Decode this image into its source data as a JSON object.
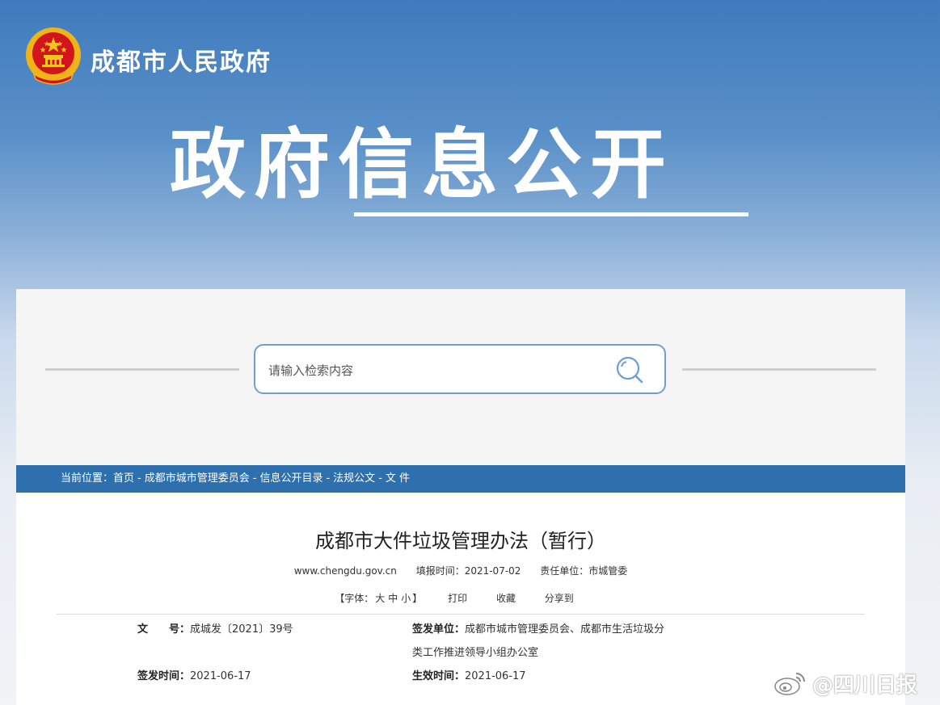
{
  "header": {
    "site_name": "成都市人民政府",
    "banner_title": "政府信息公开",
    "colors": {
      "primary_blue": "#2e6fad",
      "emblem_red": "#d2141c",
      "emblem_gold": "#f5c518"
    }
  },
  "search": {
    "placeholder": "请输入检索内容",
    "icon": "search-icon"
  },
  "breadcrumb": {
    "label": "当前位置：",
    "items": [
      "首页",
      "成都市城市管理委员会",
      "信息公开目录",
      "法规公文",
      "文 件"
    ],
    "separator": "-"
  },
  "document": {
    "title": "成都市大件垃圾管理办法（暂行）",
    "source": "www.chengdu.gov.cn",
    "fill_time": "填报时间：2021-07-02",
    "responsible_unit": "责任单位：市城管委",
    "font_size_prefix": "【字体：",
    "font_sizes": [
      "大",
      "中",
      "小"
    ],
    "font_size_suffix": "】",
    "tools": {
      "print": "打印",
      "favorite": "收藏",
      "share": "分享到"
    },
    "info": {
      "doc_no_label": "文　　号：",
      "doc_no": "成城发〔2021〕39号",
      "issuer_label": "签发单位：",
      "issuer_line1": "成都市城市管理委员会、成都市生活垃圾分",
      "issuer_line2": "类工作推进领导小组办公室",
      "issue_date_label": "签发时间：",
      "issue_date": "2021-06-17",
      "effective_date_label": "生效时间：",
      "effective_date": "2021-06-17"
    }
  },
  "watermark": {
    "text": "@四川日报",
    "icon": "weibo-icon"
  }
}
